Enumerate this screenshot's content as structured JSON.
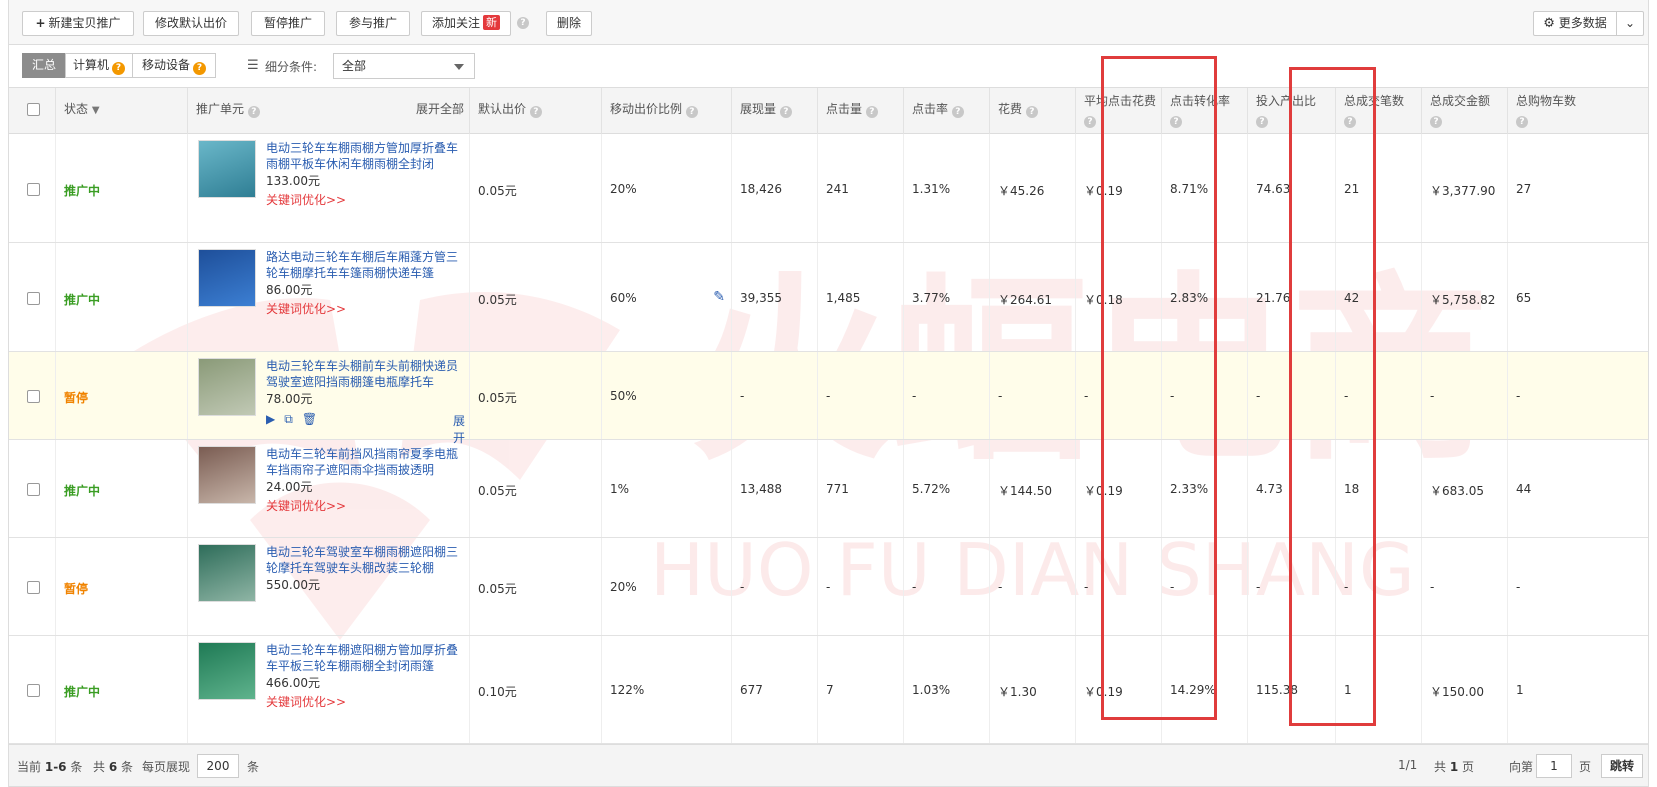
{
  "toolbar": {
    "new_promotion": "新建宝贝推广",
    "edit_default_bid": "修改默认出价",
    "pause_promotion": "暂停推广",
    "join_promotion": "参与推广",
    "add_follow": "添加关注",
    "new_badge": "新",
    "delete": "删除",
    "more_data": "更多数据"
  },
  "filter": {
    "tabs": [
      "汇总",
      "计算机",
      "移动设备"
    ],
    "segment_label": "细分条件:",
    "segment_value": "全部"
  },
  "table": {
    "headers": {
      "status": "状态",
      "unit": "推广单元",
      "expand_all": "展开全部",
      "default_bid": "默认出价",
      "mobile_ratio": "移动出价比例",
      "impressions": "展现量",
      "clicks": "点击量",
      "ctr": "点击率",
      "cost": "花费",
      "avg_cpc": "平均点击花费",
      "cvr": "点击转化率",
      "roi": "投入产出比",
      "orders": "总成交笔数",
      "gmv": "总成交金额",
      "cart": "总购物车数"
    },
    "rows": [
      {
        "status": "推广中",
        "status_type": "on",
        "title": "电动三轮车车棚雨棚方管加厚折叠车雨棚平板车休闲车棚雨棚全封闭",
        "price": "133.00元",
        "kw": "关键词优化>>",
        "default_bid": "0.05元",
        "mobile_ratio": "20%",
        "impressions": "18,426",
        "clicks": "241",
        "ctr": "1.31%",
        "cost": "￥45.26",
        "avg_cpc": "￥0.19",
        "cvr": "8.71%",
        "roi": "74.63",
        "orders": "21",
        "gmv": "￥3,377.90",
        "cart": "27"
      },
      {
        "status": "推广中",
        "status_type": "on",
        "title": "路达电动三轮车车棚后车厢蓬方管三轮车棚摩托车车篷雨棚快递车篷",
        "price": "86.00元",
        "kw": "关键词优化>>",
        "default_bid": "0.05元",
        "mobile_ratio": "60%",
        "impressions": "39,355",
        "clicks": "1,485",
        "ctr": "3.77%",
        "cost": "￥264.61",
        "avg_cpc": "￥0.18",
        "cvr": "2.83%",
        "roi": "21.76",
        "orders": "42",
        "gmv": "￥5,758.82",
        "cart": "65"
      },
      {
        "status": "暂停",
        "status_type": "off",
        "title": "电动三轮车车头棚前车头前棚快递员驾驶室遮阳挡雨棚篷电瓶摩托车",
        "price": "78.00元",
        "kw": "",
        "expand": "展开",
        "default_bid": "0.05元",
        "mobile_ratio": "50%",
        "impressions": "-",
        "clicks": "-",
        "ctr": "-",
        "cost": "-",
        "avg_cpc": "-",
        "cvr": "-",
        "roi": "-",
        "orders": "-",
        "gmv": "-",
        "cart": "-"
      },
      {
        "status": "推广中",
        "status_type": "on",
        "title": "电动车三轮车前挡风挡雨帘夏季电瓶车挡雨帘子遮阳雨伞挡雨披透明",
        "price": "24.00元",
        "kw": "关键词优化>>",
        "default_bid": "0.05元",
        "mobile_ratio": "1%",
        "impressions": "13,488",
        "clicks": "771",
        "ctr": "5.72%",
        "cost": "￥144.50",
        "avg_cpc": "￥0.19",
        "cvr": "2.33%",
        "roi": "4.73",
        "orders": "18",
        "gmv": "￥683.05",
        "cart": "44"
      },
      {
        "status": "暂停",
        "status_type": "off",
        "title": "电动三轮车驾驶室车棚雨棚遮阳棚三轮摩托车驾驶车头棚改装三轮棚",
        "price": "550.00元",
        "kw": "",
        "default_bid": "0.05元",
        "mobile_ratio": "20%",
        "impressions": "-",
        "clicks": "-",
        "ctr": "-",
        "cost": "-",
        "avg_cpc": "-",
        "cvr": "-",
        "roi": "-",
        "orders": "-",
        "gmv": "-",
        "cart": "-"
      },
      {
        "status": "推广中",
        "status_type": "on",
        "title": "电动三轮车车棚遮阳棚方管加厚折叠车平板三轮车棚雨棚全封闭雨篷",
        "price": "466.00元",
        "kw": "关键词优化>>",
        "default_bid": "0.10元",
        "mobile_ratio": "122%",
        "impressions": "677",
        "clicks": "7",
        "ctr": "1.03%",
        "cost": "￥1.30",
        "avg_cpc": "￥0.19",
        "cvr": "14.29%",
        "roi": "115.38",
        "orders": "1",
        "gmv": "￥150.00",
        "cart": "1"
      }
    ]
  },
  "footer": {
    "current": "当前",
    "range": "1-6",
    "items": "条",
    "total_prefix": "共",
    "total": "6",
    "per_page_label": "每页展现",
    "per_page": "200",
    "page_info": "1/1",
    "pages_total_prefix": "共",
    "pages_total": "1",
    "pages_unit": "页",
    "goto_label": "向第",
    "goto_value": "1",
    "goto_unit": "页",
    "goto_button": "跳转"
  },
  "watermark": {
    "cn": "火蝠电商",
    "en": "HUO FU DIAN SHANG"
  },
  "colors": {
    "status_on": "#3a9d23",
    "status_off": "#f08300",
    "link": "#2a5db0",
    "keyword_link": "#e4393c",
    "highlight_frame": "#e03c3c",
    "paused_row_bg": "#fffdea"
  }
}
